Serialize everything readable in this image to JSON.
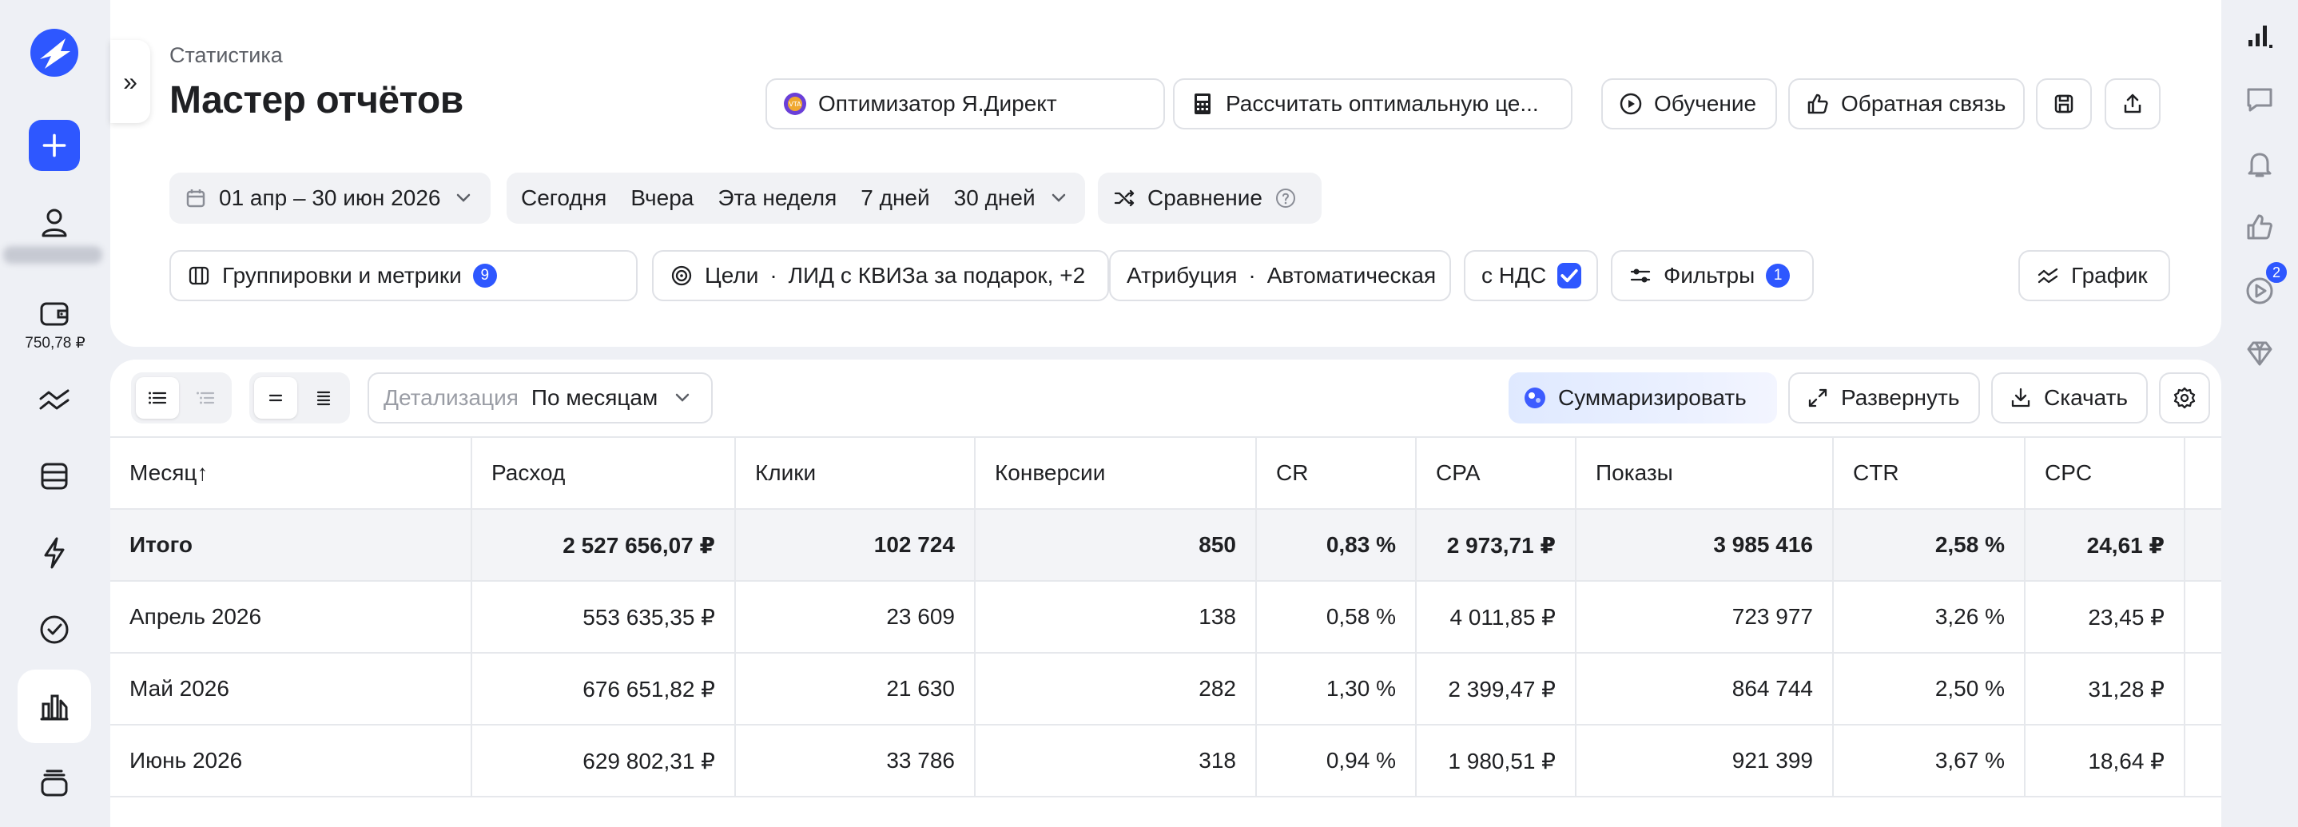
{
  "sidebar": {
    "balance": "750,78 ₽",
    "items": [
      {
        "name": "profile-icon"
      },
      {
        "name": "wallet-icon"
      },
      {
        "name": "trends-icon"
      },
      {
        "name": "database-icon"
      },
      {
        "name": "lightning-icon"
      },
      {
        "name": "check-circle-icon"
      },
      {
        "name": "reports-chart-icon",
        "active": true
      },
      {
        "name": "stack-icon"
      }
    ]
  },
  "header": {
    "breadcrumb": "Статистика",
    "title": "Мастер отчётов",
    "optimizer_label": "Оптимизатор Я.Директ",
    "calculator_label": "Рассчитать оптимальную це...",
    "learning_label": "Обучение",
    "feedback_label": "Обратная связь"
  },
  "filters": {
    "date_range": "01 апр – 30 июн 2026",
    "presets": [
      "Сегодня",
      "Вчера",
      "Эта неделя",
      "7 дней",
      "30 дней"
    ],
    "compare_label": "Сравнение",
    "groupings_label": "Группировки и метрики",
    "groupings_count": "9",
    "goals_prefix": "Цели",
    "goals_value": "ЛИД с КВИЗа за подарок, +2",
    "attribution_prefix": "Атрибуция",
    "attribution_value": "Автоматическая",
    "vat_label": "с НДС",
    "filters_label": "Фильтры",
    "filters_count": "1",
    "chart_label": "График"
  },
  "toolbar": {
    "detail_label": "Детализация",
    "detail_value": "По месяцам",
    "summarize_label": "Суммаризировать",
    "expand_label": "Развернуть",
    "download_label": "Скачать"
  },
  "right_rail": {
    "video_badge": "2"
  },
  "table": {
    "columns": [
      "Месяц↑",
      "Расход",
      "Клики",
      "Конверсии",
      "CR",
      "CPA",
      "Показы",
      "CTR",
      "CPC"
    ],
    "total": [
      "Итого",
      "2 527 656,07 ₽",
      "102 724",
      "850",
      "0,83 %",
      "2 973,71 ₽",
      "3 985 416",
      "2,58 %",
      "24,61 ₽"
    ],
    "rows": [
      [
        "Апрель 2026",
        "553 635,35 ₽",
        "23 609",
        "138",
        "0,58 %",
        "4 011,85 ₽",
        "723 977",
        "3,26 %",
        "23,45 ₽"
      ],
      [
        "Май 2026",
        "676 651,82 ₽",
        "21 630",
        "282",
        "1,30 %",
        "2 399,47 ₽",
        "864 744",
        "2,50 %",
        "31,28 ₽"
      ],
      [
        "Июнь 2026",
        "629 802,31 ₽",
        "33 786",
        "318",
        "0,94 %",
        "1 980,51 ₽",
        "921 399",
        "3,67 %",
        "18,64 ₽"
      ]
    ]
  }
}
